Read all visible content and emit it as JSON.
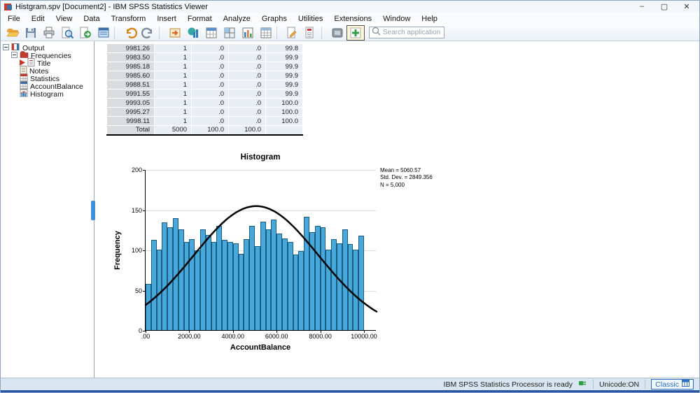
{
  "window": {
    "title": "Histgram.spv [Document2] - IBM SPSS Statistics Viewer",
    "controls": {
      "minimize": "–",
      "maximize": "▢",
      "close": "✕"
    }
  },
  "menubar": {
    "items": [
      "File",
      "Edit",
      "View",
      "Data",
      "Transform",
      "Insert",
      "Format",
      "Analyze",
      "Graphs",
      "Utilities",
      "Extensions",
      "Window",
      "Help"
    ]
  },
  "toolbar": {
    "icons": [
      {
        "name": "open-file-icon"
      },
      {
        "name": "save-icon"
      },
      {
        "name": "print-icon"
      },
      {
        "name": "print-preview-icon"
      },
      {
        "name": "export-icon"
      },
      {
        "name": "recall-dialogs-icon"
      },
      {
        "name": "sep"
      },
      {
        "name": "undo-icon"
      },
      {
        "name": "redo-icon"
      },
      {
        "name": "sep"
      },
      {
        "name": "goto-case-icon"
      },
      {
        "name": "goto-variable-icon"
      },
      {
        "name": "variables-icon"
      },
      {
        "name": "select-table-icon"
      },
      {
        "name": "chart-builder-icon"
      },
      {
        "name": "data-grid-icon"
      },
      {
        "name": "sep"
      },
      {
        "name": "edit-document-icon"
      },
      {
        "name": "insert-text-icon"
      },
      {
        "name": "sep"
      },
      {
        "name": "use-variable-sets-icon"
      },
      {
        "name": "show-all-icon",
        "active": true
      }
    ],
    "search_placeholder": "Search application"
  },
  "sidebar": {
    "tree": [
      {
        "label": "Output",
        "level": 0,
        "icon": "output-book-icon",
        "expander": true
      },
      {
        "label": "Frequencies",
        "level": 1,
        "icon": "frequencies-icon",
        "expander": true
      },
      {
        "label": "Title",
        "level": 2,
        "icon": "title-icon",
        "current": true
      },
      {
        "label": "Notes",
        "level": 2,
        "icon": "notes-icon"
      },
      {
        "label": "Statistics",
        "level": 2,
        "icon": "statistics-icon"
      },
      {
        "label": "AccountBalance",
        "level": 2,
        "icon": "table-icon"
      },
      {
        "label": "Histogram",
        "level": 2,
        "icon": "histogram-icon"
      }
    ]
  },
  "frequency_table": {
    "rows": [
      [
        "9981.26",
        "1",
        ".0",
        ".0",
        "99.8"
      ],
      [
        "9983.50",
        "1",
        ".0",
        ".0",
        "99.9"
      ],
      [
        "9985.18",
        "1",
        ".0",
        ".0",
        "99.9"
      ],
      [
        "9985.60",
        "1",
        ".0",
        ".0",
        "99.9"
      ],
      [
        "9988.51",
        "1",
        ".0",
        ".0",
        "99.9"
      ],
      [
        "9991.55",
        "1",
        ".0",
        ".0",
        "99.9"
      ],
      [
        "9993.05",
        "1",
        ".0",
        ".0",
        "100.0"
      ],
      [
        "9995.27",
        "1",
        ".0",
        ".0",
        "100.0"
      ],
      [
        "9998.11",
        "1",
        ".0",
        ".0",
        "100.0"
      ],
      [
        "Total",
        "5000",
        "100.0",
        "100.0",
        ""
      ]
    ]
  },
  "chart_data": {
    "type": "bar",
    "title": "Histogram",
    "xlabel": "AccountBalance",
    "ylabel": "Frequency",
    "x_ticks": [
      ".00",
      "2000.00",
      "4000.00",
      "6000.00",
      "8000.00",
      "10000.00"
    ],
    "x_tick_values": [
      0,
      2000,
      4000,
      6000,
      8000,
      10000
    ],
    "y_ticks": [
      0,
      50,
      100,
      150,
      200
    ],
    "xlim": [
      0,
      10000
    ],
    "ylim": [
      0,
      200
    ],
    "bin_width": 250,
    "values": [
      57,
      112,
      100,
      134,
      128,
      139,
      125,
      110,
      113,
      99,
      125,
      118,
      110,
      130,
      112,
      110,
      108,
      95,
      113,
      130,
      104,
      135,
      125,
      137,
      120,
      114,
      110,
      94,
      98,
      141,
      122,
      130,
      128,
      100,
      113,
      108,
      125,
      107,
      100,
      117
    ],
    "normal_curve": {
      "mean": 5060.57,
      "sd": 2849.356,
      "n": 5000,
      "peak": 155
    },
    "annotation_lines": [
      "Mean = 5060.57",
      "Std. Dev. = 2849.356",
      "N = 5,000"
    ],
    "bar_color": "#47a8dc",
    "bar_border": "#1b5c7e",
    "curve_color": "#000000",
    "legend_position": "none",
    "grid": true
  },
  "statusbar": {
    "processor": "IBM SPSS Statistics Processor is ready",
    "unicode": "Unicode:ON",
    "mode": "Classic"
  }
}
